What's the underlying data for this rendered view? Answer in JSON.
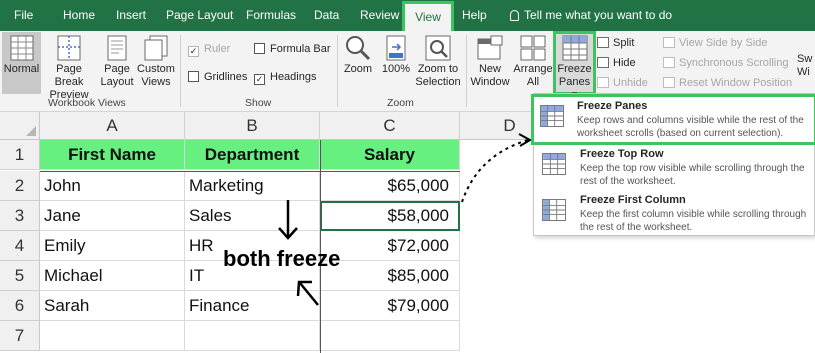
{
  "tabs": [
    "File",
    "Home",
    "Insert",
    "Page Layout",
    "Formulas",
    "Data",
    "Review",
    "View",
    "Help"
  ],
  "active_tab": "View",
  "tell_me": "Tell me what you want to do",
  "ribbon": {
    "workbook_views": {
      "label": "Workbook Views",
      "normal": "Normal",
      "page_break_1": "Page Break",
      "page_break_2": "Preview",
      "page_layout_1": "Page",
      "page_layout_2": "Layout",
      "custom_1": "Custom",
      "custom_2": "Views"
    },
    "show": {
      "label": "Show",
      "ruler": "Ruler",
      "formula_bar": "Formula Bar",
      "gridlines": "Gridlines",
      "headings": "Headings"
    },
    "zoom": {
      "label": "Zoom",
      "zoom": "Zoom",
      "hundred": "100%",
      "zoom_to_1": "Zoom to",
      "zoom_to_2": "Selection"
    },
    "window": {
      "new_1": "New",
      "new_2": "Window",
      "arrange_1": "Arrange",
      "arrange_2": "All",
      "freeze_1": "Freeze",
      "freeze_2": "Panes",
      "split": "Split",
      "hide": "Hide",
      "unhide": "Unhide",
      "side_by_side": "View Side by Side",
      "sync_scroll": "Synchronous Scrolling",
      "reset_pos": "Reset Window Position",
      "switch_cut": "Sw",
      "switch_cut2": "Wi"
    }
  },
  "columns": [
    "A",
    "B",
    "C",
    "D"
  ],
  "rows": [
    "1",
    "2",
    "3",
    "4",
    "5",
    "6",
    "7"
  ],
  "table": {
    "headers": [
      "First Name",
      "Department",
      "Salary"
    ],
    "data": [
      [
        "John",
        "Marketing",
        "$65,000"
      ],
      [
        "Jane",
        "Sales",
        "$58,000"
      ],
      [
        "Emily",
        "HR",
        "$72,000"
      ],
      [
        "Michael",
        "IT",
        "$85,000"
      ],
      [
        "Sarah",
        "Finance",
        "$79,000"
      ]
    ]
  },
  "annotation": "both freeze",
  "menu": {
    "items": [
      {
        "title": "Freeze Panes",
        "desc": "Keep rows and columns visible while the rest of the worksheet scrolls (based on current selection)."
      },
      {
        "title": "Freeze Top Row",
        "desc": "Keep the top row visible while scrolling through the rest of the worksheet."
      },
      {
        "title": "Freeze First Column",
        "desc": "Keep the first column visible while scrolling through the rest of the worksheet."
      }
    ]
  },
  "colors": {
    "ribbon_green": "#217346",
    "highlight_green": "#3ec35f",
    "header_fill": "#66f07f"
  }
}
